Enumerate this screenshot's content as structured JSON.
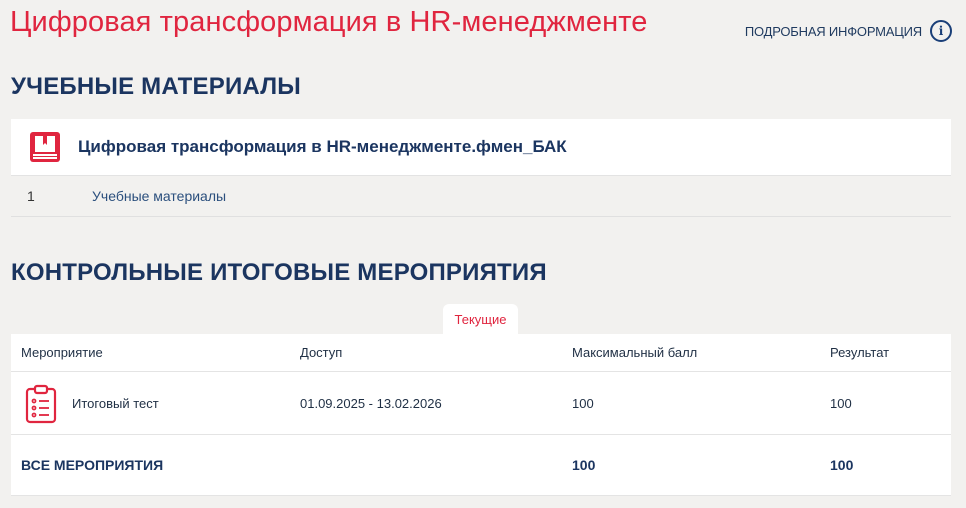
{
  "header": {
    "title": "Цифровая трансформация в HR-менеджменте",
    "more_info_label": "ПОДРОБНАЯ ИНФОРМАЦИЯ",
    "info_icon": "info-icon",
    "accent_color": "#e0253f"
  },
  "materials": {
    "section_title": "УЧЕБНЫЕ МАТЕРИАЛЫ",
    "course_icon": "book-icon",
    "course_name": "Цифровая трансформация в HR-менеджменте.фмен_БАК",
    "rows": [
      {
        "num": "1",
        "label": "Учебные материалы"
      }
    ]
  },
  "events": {
    "section_title": "КОНТРОЛЬНЫЕ ИТОГОВЫЕ МЕРОПРИЯТИЯ",
    "tab_label": "Текущие",
    "columns": [
      "Мероприятие",
      "Доступ",
      "Максимальный балл",
      "Результат"
    ],
    "rows": [
      {
        "icon": "clipboard-list-icon",
        "name": "Итоговый тест",
        "access": "01.09.2025 - 13.02.2026",
        "max_score": "100",
        "result": "100"
      }
    ],
    "total": {
      "label": "ВСЕ МЕРОПРИЯТИЯ",
      "max_score": "100",
      "result": "100"
    }
  }
}
